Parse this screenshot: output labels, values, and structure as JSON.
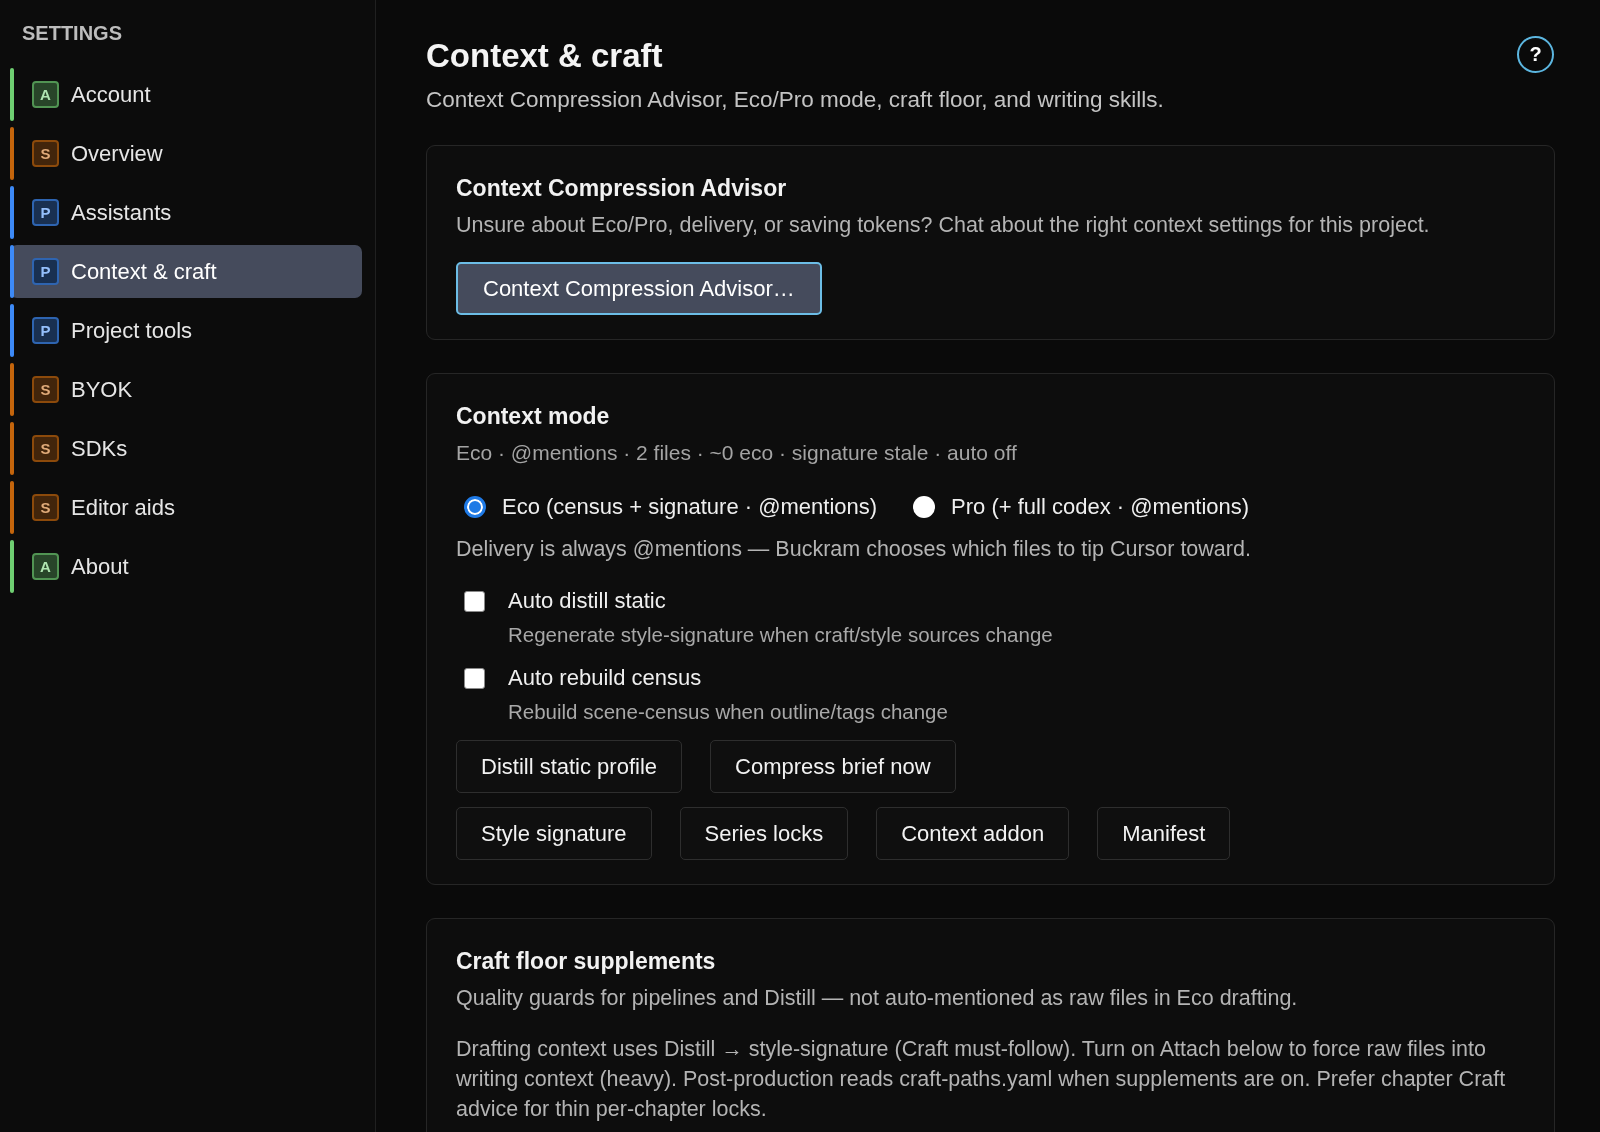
{
  "sidebar": {
    "heading": "SETTINGS",
    "items": [
      {
        "label": "Account",
        "badge": "A",
        "color": "#6fcf72",
        "selected": false
      },
      {
        "label": "Overview",
        "badge": "S",
        "color": "#c4650c",
        "selected": false
      },
      {
        "label": "Assistants",
        "badge": "P",
        "color": "#3d8af7",
        "selected": false
      },
      {
        "label": "Context & craft",
        "badge": "P",
        "color": "#3d8af7",
        "selected": true
      },
      {
        "label": "Project tools",
        "badge": "P",
        "color": "#3d8af7",
        "selected": false
      },
      {
        "label": "BYOK",
        "badge": "S",
        "color": "#c4650c",
        "selected": false
      },
      {
        "label": "SDKs",
        "badge": "S",
        "color": "#c4650c",
        "selected": false
      },
      {
        "label": "Editor aids",
        "badge": "S",
        "color": "#c4650c",
        "selected": false
      },
      {
        "label": "About",
        "badge": "A",
        "color": "#6fcf72",
        "selected": false
      }
    ]
  },
  "page": {
    "title": "Context & craft",
    "subtitle": "Context Compression Advisor, Eco/Pro mode, craft floor, and writing skills.",
    "help_button": "?"
  },
  "advisor_card": {
    "title": "Context Compression Advisor",
    "description": "Unsure about Eco/Pro, delivery, or saving tokens? Chat about the right context settings for this project.",
    "button": "Context Compression Advisor…"
  },
  "context_mode_card": {
    "title": "Context mode",
    "status": "Eco · @mentions · 2 files · ~0 eco · signature stale · auto off",
    "radios": [
      {
        "label": "Eco (census + signature · @mentions)",
        "selected": true
      },
      {
        "label": "Pro (+ full codex · @mentions)",
        "selected": false
      }
    ],
    "note": "Delivery is always @mentions — Buckram chooses which files to tip Cursor toward.",
    "checkboxes": [
      {
        "label": "Auto distill static",
        "description": "Regenerate style-signature when craft/style sources change",
        "checked": false
      },
      {
        "label": "Auto rebuild census",
        "description": "Rebuild scene-census when outline/tags change",
        "checked": false
      }
    ],
    "button_rows": [
      [
        "Distill static profile",
        "Compress brief now"
      ],
      [
        "Style signature",
        "Series locks",
        "Context addon",
        "Manifest"
      ]
    ]
  },
  "craft_floor_card": {
    "title": "Craft floor supplements",
    "description": "Quality guards for pipelines and Distill — not auto-mentioned as raw files in Eco drafting.",
    "body": "Drafting context uses Distill → style-signature (Craft must-follow). Turn on Attach below to force raw files into writing context (heavy). Post-production reads craft-paths.yaml when supplements are on. Prefer chapter Craft advice for thin per-chapter locks."
  }
}
